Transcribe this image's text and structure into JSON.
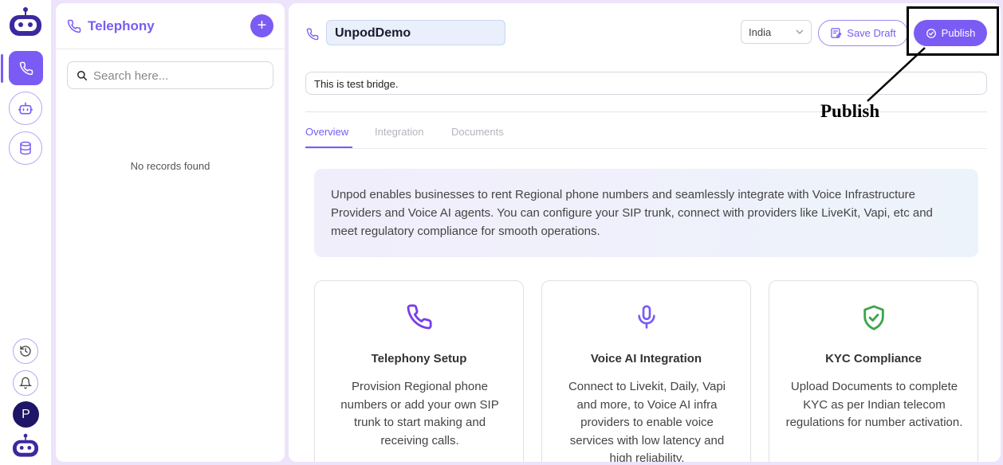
{
  "sidebar": {
    "icons": [
      "bot-logo-icon",
      "phone-icon",
      "bot-icon",
      "database-icon",
      "history-icon",
      "bell-icon"
    ],
    "avatar_initial": "P"
  },
  "panel": {
    "title": "Telephony",
    "add_label": "+",
    "search_placeholder": "Search here...",
    "empty_text": "No records found"
  },
  "header": {
    "bridge_name": "UnpodDemo",
    "country": "India",
    "save_draft_label": "Save Draft",
    "publish_label": "Publish"
  },
  "description": "This is test bridge.",
  "tabs": [
    {
      "label": "Overview",
      "active": true
    },
    {
      "label": "Integration",
      "active": false
    },
    {
      "label": "Documents",
      "active": false
    }
  ],
  "info_text": "Unpod enables businesses to rent Regional phone numbers and seamlessly integrate with Voice Infrastructure Providers and Voice AI agents. You can configure your SIP trunk, connect with providers like LiveKit, Vapi, etc and meet regulatory compliance for smooth operations.",
  "cards": [
    {
      "icon": "phone-icon",
      "title": "Telephony Setup",
      "text": "Provision Regional phone numbers or add your own SIP trunk to start making and receiving calls."
    },
    {
      "icon": "microphone-icon",
      "title": "Voice AI Integration",
      "text": "Connect to Livekit, Daily, Vapi and more, to Voice AI infra providers to enable voice services with low latency and high reliability."
    },
    {
      "icon": "shield-check-icon",
      "title": "KYC Compliance",
      "text": "Upload Documents to complete KYC as per Indian telecom regulations for number activation."
    }
  ],
  "annotation": {
    "label": "Publish"
  },
  "colors": {
    "accent": "#7a5cf4",
    "shield": "#3aa64a",
    "background": "#ede4fb"
  }
}
